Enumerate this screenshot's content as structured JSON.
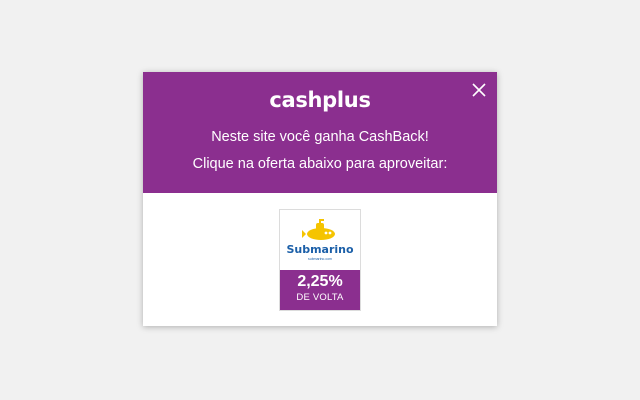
{
  "popup": {
    "logo": "cashplus",
    "line1": "Neste site você ganha CashBack!",
    "line2": "Clique na oferta abaixo para aproveitar:",
    "close_icon": "close-icon",
    "brand_color": "#8b2f8f"
  },
  "offer": {
    "store_logo_text": "Submarino",
    "store_logo_subtext": "submarino.com",
    "cashback_percent": "2,25%",
    "cashback_label": "DE VOLTA",
    "logo_icon": "submarine-icon",
    "logo_colors": {
      "submarine": "#f5c400",
      "wordmark": "#1b5fa8"
    }
  }
}
